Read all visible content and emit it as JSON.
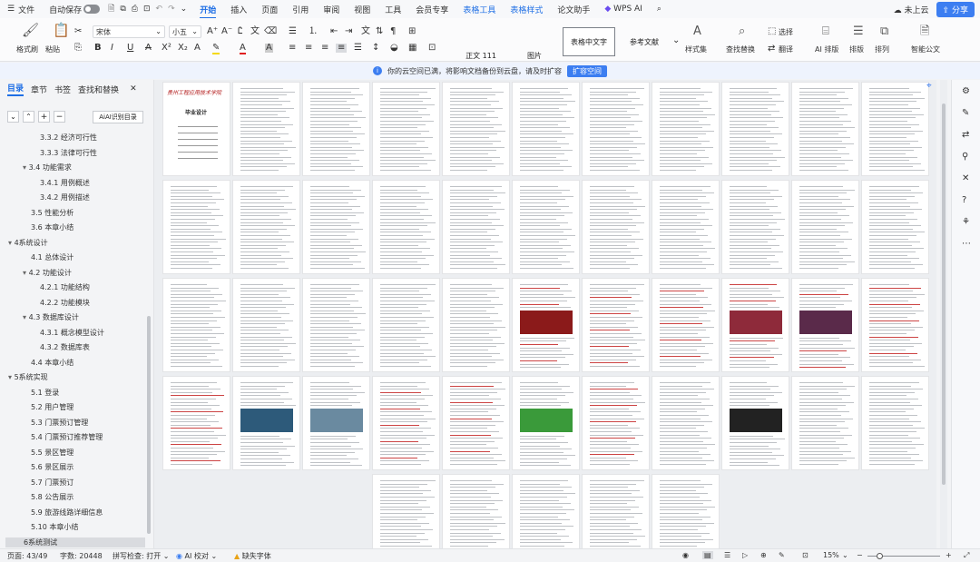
{
  "menu": {
    "file": "文件",
    "autosave": "自动保存",
    "tabs": [
      "开始",
      "插入",
      "页面",
      "引用",
      "审阅",
      "视图",
      "工具",
      "会员专享"
    ],
    "context_tabs": [
      "表格工具",
      "表格样式"
    ],
    "extra_tabs": [
      "论文助手"
    ],
    "wps_ai": "WPS AI",
    "cloud": "未上云",
    "share": "分享"
  },
  "ribbon": {
    "format_painter": "格式刷",
    "paste": "粘贴",
    "font_name": "宋体",
    "font_size": "小五",
    "styles": [
      "正文 111",
      "图片",
      "表格中文字",
      "参考文献"
    ],
    "style_set": "样式集",
    "find_replace": "查找替换",
    "select": "选择",
    "translate": "翻译",
    "ai_layout": "AI 排版",
    "layout": "排版",
    "arrange": "排列",
    "smart_doc": "智能公文"
  },
  "notice": {
    "text": "你的云空间已满，将影响文档备份到云盘，请及时扩容",
    "button": "扩容空间"
  },
  "sidebar": {
    "tabs": [
      "目录",
      "章节",
      "书签",
      "查找和替换"
    ],
    "ai_toc": "AI识别目录",
    "toc": [
      {
        "label": "3.3.2 经济可行性",
        "level": 3
      },
      {
        "label": "3.3.3 法律可行性",
        "level": 3
      },
      {
        "label": "3.4 功能需求",
        "level": 2,
        "expanded": true
      },
      {
        "label": "3.4.1 用例概述",
        "level": 3
      },
      {
        "label": "3.4.2 用例描述",
        "level": 3
      },
      {
        "label": "3.5 性能分析",
        "level": 2
      },
      {
        "label": "3.6 本章小结",
        "level": 2
      },
      {
        "label": "4系统设计",
        "level": 1,
        "expanded": true
      },
      {
        "label": "4.1 总体设计",
        "level": 2
      },
      {
        "label": "4.2 功能设计",
        "level": 2,
        "expanded": true
      },
      {
        "label": "4.2.1 功能结构",
        "level": 3
      },
      {
        "label": "4.2.2 功能模块",
        "level": 3
      },
      {
        "label": "4.3 数据库设计",
        "level": 2,
        "expanded": true
      },
      {
        "label": "4.3.1 概念模型设计",
        "level": 3
      },
      {
        "label": "4.3.2 数据库表",
        "level": 3
      },
      {
        "label": "4.4 本章小结",
        "level": 2
      },
      {
        "label": "5系统实现",
        "level": 1,
        "expanded": true
      },
      {
        "label": "5.1 登录",
        "level": 2
      },
      {
        "label": "5.2 用户管理",
        "level": 2
      },
      {
        "label": "5.3 门票预订管理",
        "level": 2
      },
      {
        "label": "5.4 门票预订推荐管理",
        "level": 2
      },
      {
        "label": "5.5 景区管理",
        "level": 2
      },
      {
        "label": "5.6 景区展示",
        "level": 2
      },
      {
        "label": "5.7 门票预订",
        "level": 2
      },
      {
        "label": "5.8 公告展示",
        "level": 2
      },
      {
        "label": "5.9 旅游线路详细信息",
        "level": 2
      },
      {
        "label": "5.10 本章小结",
        "level": 2
      },
      {
        "label": "6系统测试",
        "level": 1,
        "selected": true
      }
    ]
  },
  "cover": {
    "school": "贵州工程应用技术学院",
    "title": "毕业设计"
  },
  "status": {
    "page": "页面: 43/49",
    "words": "字数: 20448",
    "spell": "拼写检查: 打开",
    "ai_check": "AI 校对",
    "missing_font": "缺失字体",
    "zoom": "15%"
  },
  "colors": {
    "accent": "#1f6fe5",
    "share": "#3c7ef1"
  }
}
